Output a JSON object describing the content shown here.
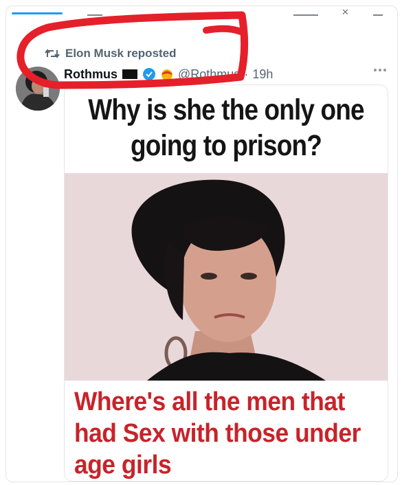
{
  "repost": {
    "label": "Elon Musk reposted"
  },
  "post": {
    "author_name": "Rothmus",
    "handle": "@Rothmus",
    "separator": "·",
    "time": "19h"
  },
  "meme": {
    "top_text": "Why is she the only one going to prison?",
    "bottom_text": "Where's all the men that had Sex with those under age girls"
  },
  "colors": {
    "accent": "#1d9bf0",
    "highlight": "#e5202a",
    "meme_caption": "#c8232a"
  },
  "icons": [
    "retweet-icon",
    "flag-icon",
    "verified-icon",
    "emoji-icon",
    "more-icon"
  ]
}
